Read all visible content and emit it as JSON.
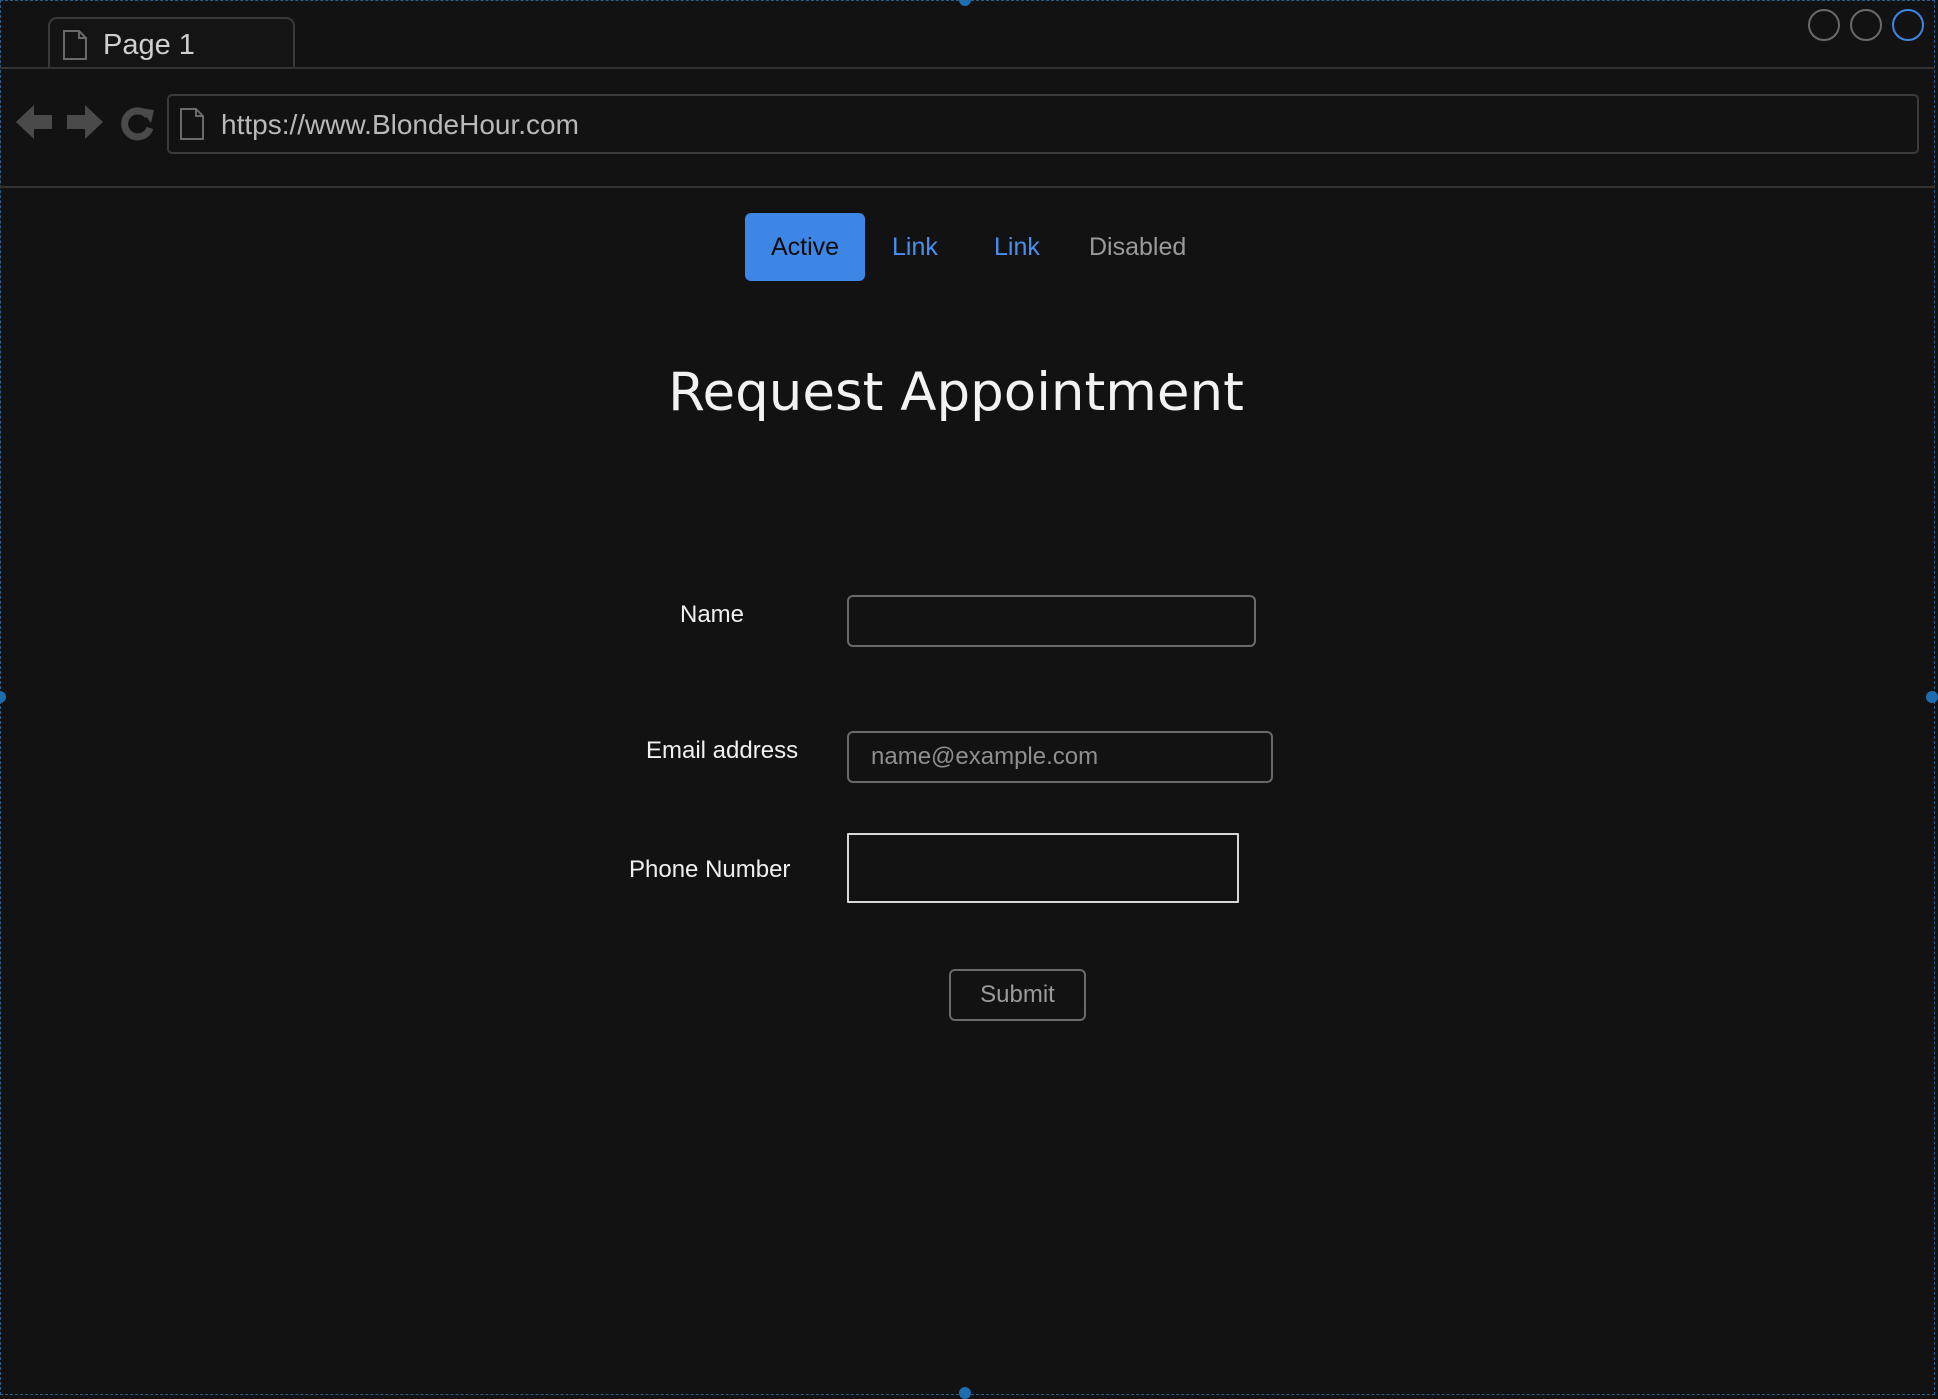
{
  "browser": {
    "tab_title": "Page 1",
    "url": "https://www.BlondeHour.com"
  },
  "nav": {
    "items": [
      {
        "label": "Active",
        "state": "active"
      },
      {
        "label": "Link",
        "state": "link"
      },
      {
        "label": "Link",
        "state": "link"
      },
      {
        "label": "Disabled",
        "state": "disabled"
      }
    ]
  },
  "page": {
    "title": "Request Appointment"
  },
  "form": {
    "name_label": "Name",
    "name_value": "",
    "email_label": "Email address",
    "email_placeholder": "name@example.com",
    "phone_label": "Phone Number",
    "phone_value": "",
    "submit_label": "Submit"
  },
  "colors": {
    "background": "#121212",
    "accent": "#3d86e6",
    "link": "#4a8ff0",
    "disabled": "#9a9a9a"
  },
  "icons": [
    "page-icon",
    "back-arrow-icon",
    "forward-arrow-icon",
    "reload-icon",
    "window-control-icon"
  ]
}
